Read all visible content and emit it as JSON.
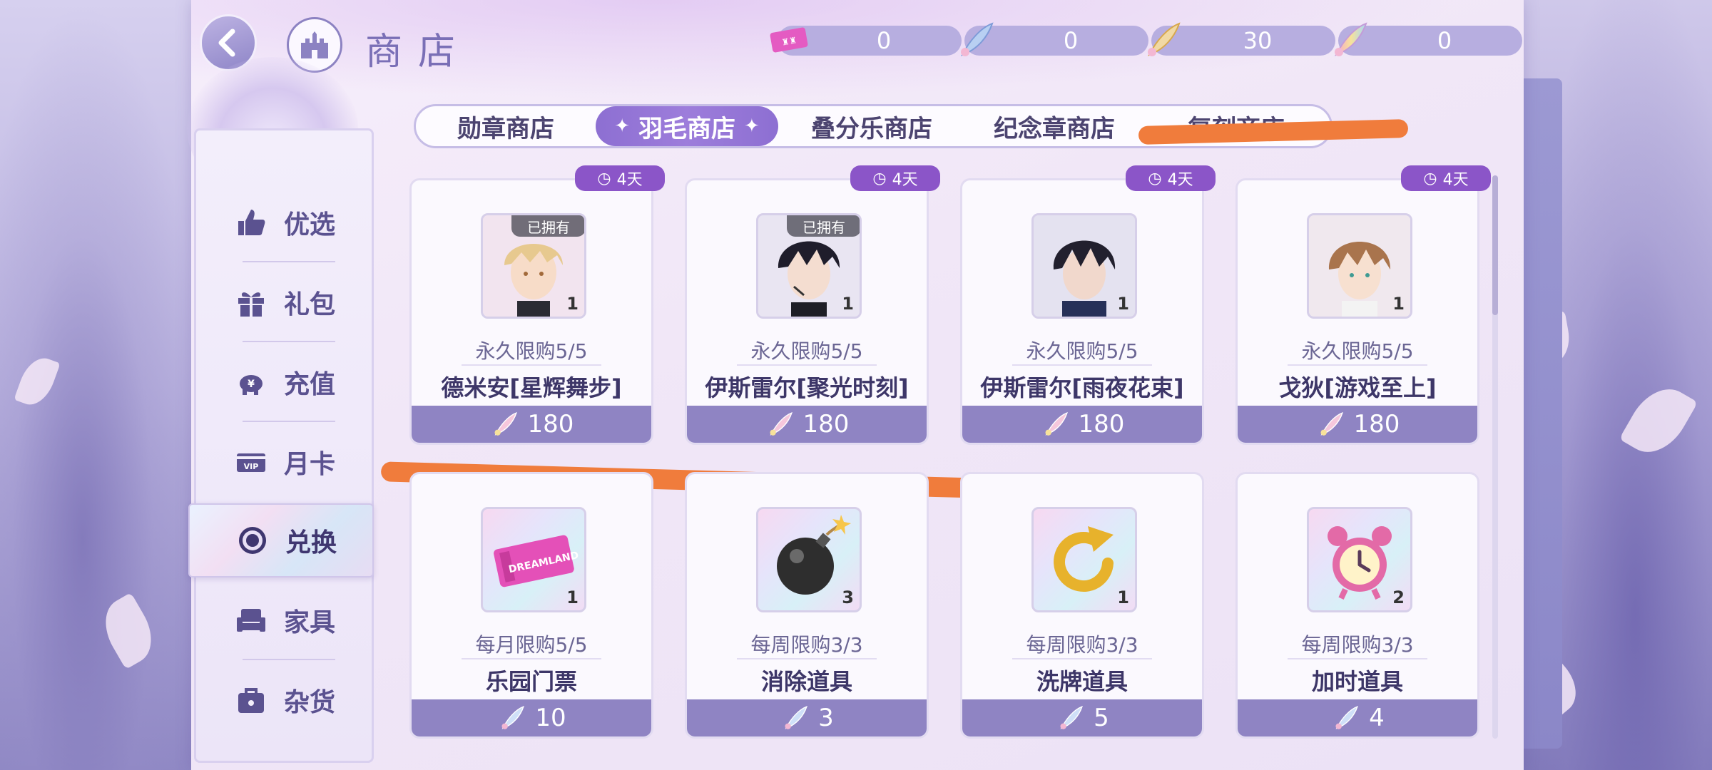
{
  "header": {
    "title": "商店",
    "currencies": [
      {
        "icon": "ticket-icon",
        "value": "0"
      },
      {
        "icon": "blue-feather-icon",
        "value": "0"
      },
      {
        "icon": "gold-feather-icon",
        "value": "30"
      },
      {
        "icon": "rainbow-feather-icon",
        "value": "0"
      }
    ]
  },
  "tabs": [
    {
      "label": "勋章商店"
    },
    {
      "label": "羽毛商店",
      "active": true
    },
    {
      "label": "叠分乐商店"
    },
    {
      "label": "纪念章商店"
    },
    {
      "label": "复刻商店"
    }
  ],
  "sidebar": {
    "items": [
      {
        "label": "优选",
        "icon": "thumbs-up-icon"
      },
      {
        "label": "礼包",
        "icon": "gift-icon"
      },
      {
        "label": "充值",
        "icon": "piggy-bank-icon"
      },
      {
        "label": "月卡",
        "icon": "vip-card-icon"
      },
      {
        "label": "兑换",
        "icon": "exchange-icon",
        "active": true
      },
      {
        "label": "家具",
        "icon": "sofa-icon"
      },
      {
        "label": "杂货",
        "icon": "bag-icon"
      }
    ]
  },
  "items": [
    {
      "timer": "4天",
      "owned": "已拥有",
      "qty": "1",
      "limit": "永久限购5/5",
      "name": "德米安[星辉舞步]",
      "price": "180",
      "thumb": "blond-character-portrait"
    },
    {
      "timer": "4天",
      "owned": "已拥有",
      "qty": "1",
      "limit": "永久限购5/5",
      "name": "伊斯雷尔[聚光时刻]",
      "price": "180",
      "thumb": "dark-hair-character-headset-portrait"
    },
    {
      "timer": "4天",
      "owned": "",
      "qty": "1",
      "limit": "永久限购5/5",
      "name": "伊斯雷尔[雨夜花束]",
      "price": "180",
      "thumb": "dark-hair-character-portrait"
    },
    {
      "timer": "4天",
      "owned": "",
      "qty": "1",
      "limit": "永久限购5/5",
      "name": "戈狄[游戏至上]",
      "price": "180",
      "thumb": "brown-hair-character-portrait"
    },
    {
      "timer": "",
      "owned": "",
      "qty": "1",
      "limit": "每月限购5/5",
      "name": "乐园门票",
      "price": "10",
      "thumb": "park-ticket-icon"
    },
    {
      "timer": "",
      "owned": "",
      "qty": "3",
      "limit": "每周限购3/3",
      "name": "消除道具",
      "price": "3",
      "thumb": "bomb-icon"
    },
    {
      "timer": "",
      "owned": "",
      "qty": "1",
      "limit": "每周限购3/3",
      "name": "洗牌道具",
      "price": "5",
      "thumb": "refresh-icon"
    },
    {
      "timer": "",
      "owned": "",
      "qty": "2",
      "limit": "每周限购3/3",
      "name": "加时道具",
      "price": "4",
      "thumb": "alarm-clock-icon"
    }
  ],
  "colors": {
    "accent": "#8d6fd2",
    "price_bar": "#8f84c3",
    "timer_badge": "#8b55c8",
    "scribble": "#f07c3c"
  }
}
